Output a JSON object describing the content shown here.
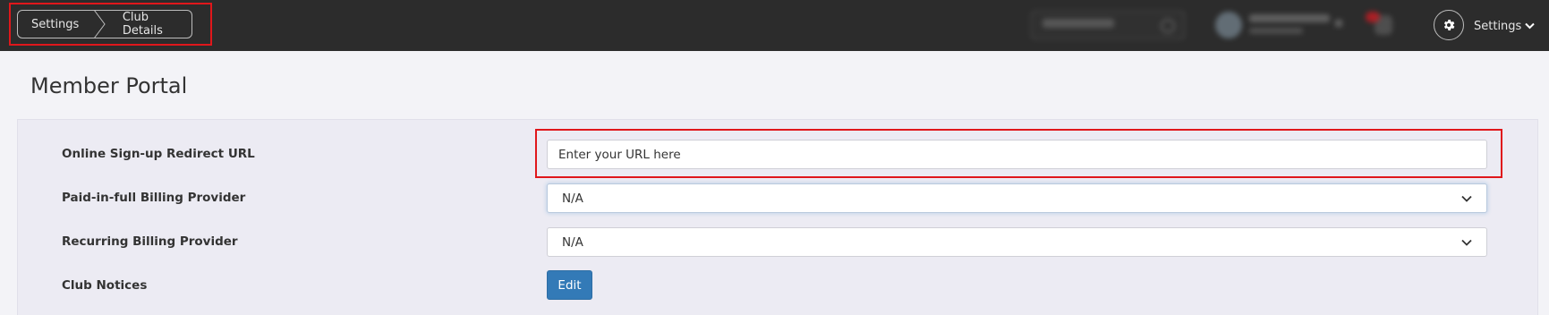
{
  "breadcrumb": {
    "items": [
      "Settings",
      "Club Details"
    ]
  },
  "header": {
    "settings_label": "Settings"
  },
  "page": {
    "title": "Member Portal"
  },
  "form": {
    "redirect_url": {
      "label": "Online Sign-up Redirect URL",
      "value": "Enter your URL here"
    },
    "paid_in_full": {
      "label": "Paid-in-full Billing Provider",
      "value": "N/A"
    },
    "recurring": {
      "label": "Recurring Billing Provider",
      "value": "N/A"
    },
    "club_notices": {
      "label": "Club Notices",
      "button": "Edit"
    }
  },
  "colors": {
    "topbar": "#2c2c2c",
    "highlight": "#e0171b",
    "primary_button": "#337ab7",
    "page_bg": "#f3f3f7"
  },
  "icons": [
    "gear-icon",
    "chevron-down-icon"
  ]
}
